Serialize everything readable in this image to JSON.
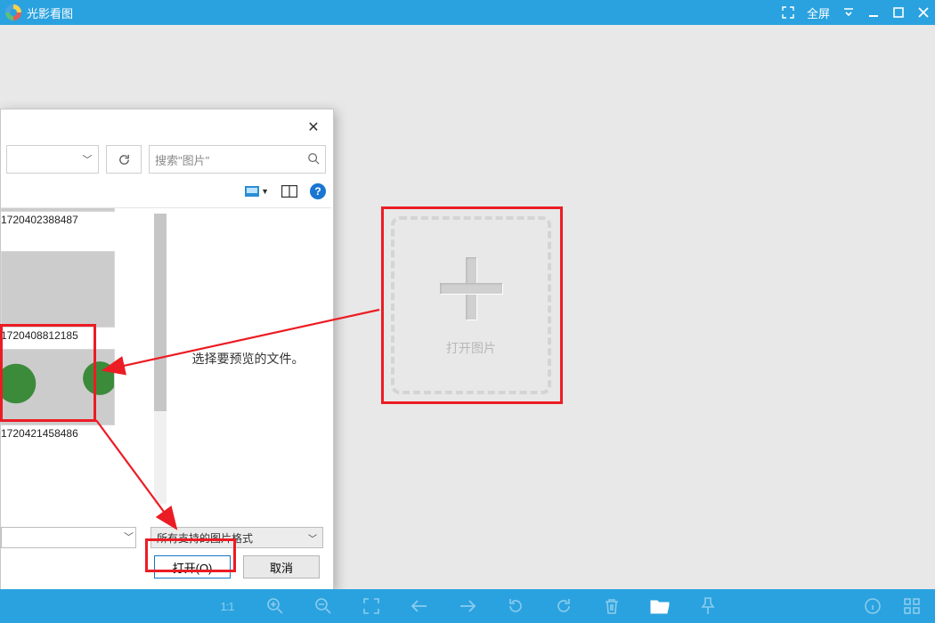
{
  "app": {
    "title": "光影看图"
  },
  "window": {
    "fullscreen_label": "全屏"
  },
  "dropzone": {
    "label": "打开图片"
  },
  "dialog": {
    "search_placeholder": "搜索\"图片\"",
    "preview_hint": "选择要预览的文件。",
    "files": [
      {
        "name": "1720402388487"
      },
      {
        "name": "1720408812185"
      },
      {
        "name": "1720421458486"
      }
    ],
    "filetype_label": "所有支持的图片格式",
    "open_label": "打开(O)",
    "cancel_label": "取消"
  },
  "bottombar": {
    "ratio": "1:1"
  }
}
